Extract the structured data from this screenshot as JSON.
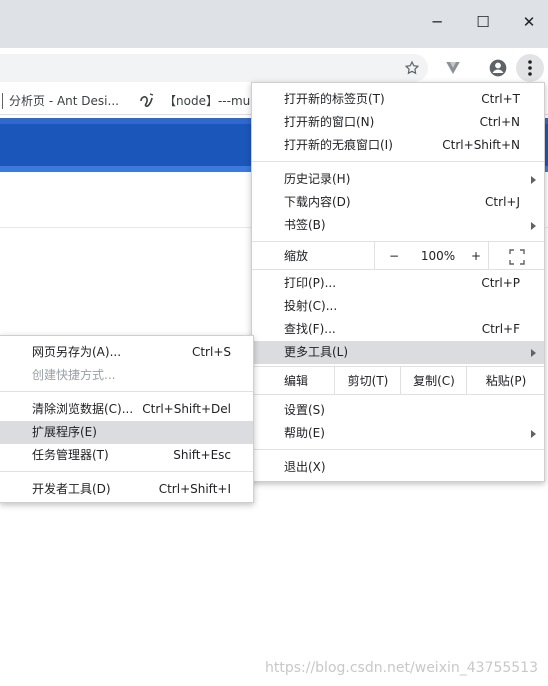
{
  "window": {
    "minimize": "─",
    "maximize": "☐",
    "close": "✕"
  },
  "toolbar": {
    "star_icon": "star-icon",
    "vpn_icon": "vpn-extension-icon",
    "account_icon": "account-icon",
    "menu_icon": "more-vert-icon"
  },
  "bookmarks": {
    "items": [
      {
        "label": "分析页 - Ant Desi..."
      },
      {
        "label": "【node】---mu"
      }
    ]
  },
  "main_menu": {
    "new_tab": {
      "label": "打开新的标签页(T)",
      "shortcut": "Ctrl+T"
    },
    "new_window": {
      "label": "打开新的窗口(N)",
      "shortcut": "Ctrl+N"
    },
    "incognito": {
      "label": "打开新的无痕窗口(I)",
      "shortcut": "Ctrl+Shift+N"
    },
    "history": {
      "label": "历史记录(H)"
    },
    "downloads": {
      "label": "下载内容(D)",
      "shortcut": "Ctrl+J"
    },
    "bookmarks": {
      "label": "书签(B)"
    },
    "zoom": {
      "label": "缩放",
      "minus": "−",
      "value": "100%",
      "plus": "+",
      "fullscreen": "⛶"
    },
    "print": {
      "label": "打印(P)...",
      "shortcut": "Ctrl+P"
    },
    "cast": {
      "label": "投射(C)..."
    },
    "find": {
      "label": "查找(F)...",
      "shortcut": "Ctrl+F"
    },
    "more_tools": {
      "label": "更多工具(L)"
    },
    "edit": {
      "label": "编辑",
      "cut": "剪切(T)",
      "copy": "复制(C)",
      "paste": "粘贴(P)"
    },
    "settings": {
      "label": "设置(S)"
    },
    "help": {
      "label": "帮助(E)"
    },
    "exit": {
      "label": "退出(X)"
    }
  },
  "sub_menu": {
    "save_page": {
      "label": "网页另存为(A)...",
      "shortcut": "Ctrl+S"
    },
    "create_shortcut": {
      "label": "创建快捷方式..."
    },
    "clear_data": {
      "label": "清除浏览数据(C)...",
      "shortcut": "Ctrl+Shift+Del"
    },
    "extensions": {
      "label": "扩展程序(E)"
    },
    "task_manager": {
      "label": "任务管理器(T)",
      "shortcut": "Shift+Esc"
    },
    "dev_tools": {
      "label": "开发者工具(D)",
      "shortcut": "Ctrl+Shift+I"
    }
  },
  "watermark": "https://blog.csdn.net/weixin_43755513"
}
